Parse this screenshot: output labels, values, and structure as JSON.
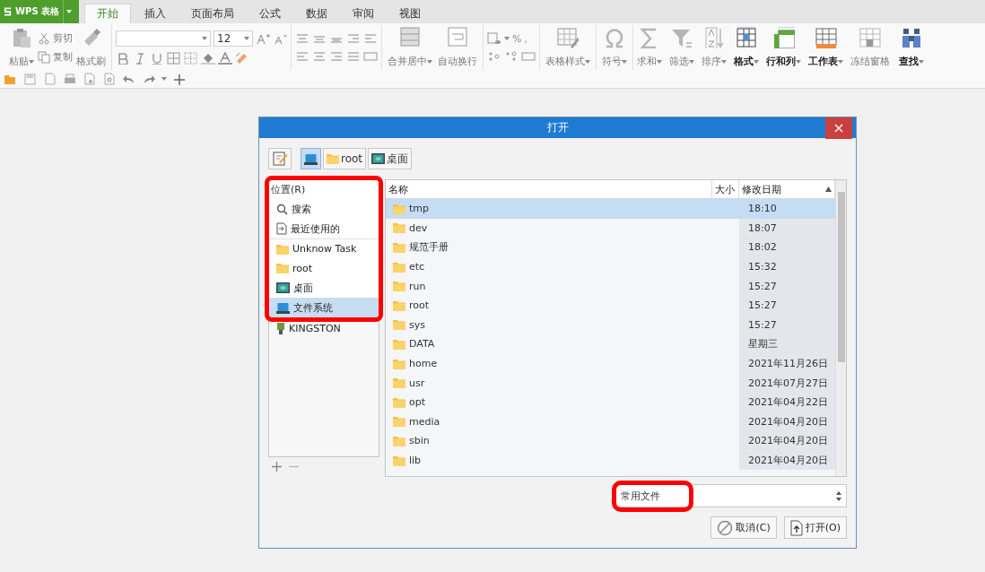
{
  "app_button": {
    "label": "WPS 表格"
  },
  "tabs": [
    {
      "label": "开始",
      "selected": true
    },
    {
      "label": "插入",
      "selected": false
    },
    {
      "label": "页面布局",
      "selected": false
    },
    {
      "label": "公式",
      "selected": false
    },
    {
      "label": "数据",
      "selected": false
    },
    {
      "label": "审阅",
      "selected": false
    },
    {
      "label": "视图",
      "selected": false
    }
  ],
  "ribbon": {
    "clipboard": [
      {
        "kind": "large",
        "label": "粘贴",
        "menu": true,
        "disabled": true
      },
      {
        "kind": "pair",
        "items": [
          {
            "label": "剪切",
            "disabled": true
          },
          {
            "label": "复制",
            "disabled": true
          }
        ]
      },
      {
        "kind": "large",
        "label": "格式刷",
        "menu": false,
        "disabled": true
      }
    ],
    "font_size": "12",
    "merge": [
      {
        "label": "合并居中",
        "menu": true,
        "disabled": true
      },
      {
        "label": "自动换行",
        "menu": false,
        "disabled": true
      }
    ],
    "number_symbols": [
      "%",
      ","
    ],
    "commands": [
      {
        "label": "表格样式",
        "menu": true,
        "disabled": true
      },
      {
        "label": "符号",
        "menu": true,
        "disabled": true
      },
      {
        "label": "求和",
        "menu": true,
        "disabled": true
      },
      {
        "label": "筛选",
        "menu": true,
        "disabled": true
      },
      {
        "label": "排序",
        "menu": true,
        "disabled": true
      },
      {
        "label": "格式",
        "menu": true,
        "disabled": false
      },
      {
        "label": "行和列",
        "menu": true,
        "disabled": false
      },
      {
        "label": "工作表",
        "menu": true,
        "disabled": false
      },
      {
        "label": "冻结窗格",
        "menu": false,
        "disabled": true
      },
      {
        "label": "查找",
        "menu": true,
        "disabled": false
      }
    ]
  },
  "dialog": {
    "title": "打开",
    "path": [
      {
        "kind": "drive",
        "selected": true
      },
      {
        "kind": "folder",
        "label": "root",
        "selected": false
      },
      {
        "kind": "desktop",
        "label": "桌面",
        "selected": false
      }
    ],
    "places": {
      "header": "位置(R)",
      "highlighted": true,
      "items": [
        {
          "kind": "search",
          "label": "搜索",
          "selected": false
        },
        {
          "kind": "recent",
          "label": "最近使用的",
          "selected": false
        },
        {
          "kind": "folder",
          "label": "Unknow Task",
          "selected": false
        },
        {
          "kind": "folder",
          "label": "root",
          "selected": false
        },
        {
          "kind": "desktop",
          "label": "桌面",
          "selected": false
        },
        {
          "kind": "drive",
          "label": "文件系统",
          "selected": true
        }
      ],
      "extra": [
        {
          "kind": "usb",
          "label": "KINGSTON",
          "selected": false
        }
      ]
    },
    "columns": [
      {
        "label": "名称",
        "sorted": false
      },
      {
        "label": "大小",
        "sorted": false
      },
      {
        "label": "修改日期",
        "sorted": true
      }
    ],
    "files": [
      {
        "name": "tmp",
        "modified": "18:10",
        "selected": true
      },
      {
        "name": "dev",
        "modified": "18:07",
        "selected": false
      },
      {
        "name": "规范手册",
        "modified": "18:02",
        "selected": false
      },
      {
        "name": "etc",
        "modified": "15:32",
        "selected": false
      },
      {
        "name": "run",
        "modified": "15:27",
        "selected": false
      },
      {
        "name": "root",
        "modified": "15:27",
        "selected": false
      },
      {
        "name": "sys",
        "modified": "15:27",
        "selected": false
      },
      {
        "name": "DATA",
        "modified": "星期三",
        "selected": false
      },
      {
        "name": "home",
        "modified": "2021年11月26日",
        "selected": false
      },
      {
        "name": "usr",
        "modified": "2021年07月27日",
        "selected": false
      },
      {
        "name": "opt",
        "modified": "2021年04月22日",
        "selected": false
      },
      {
        "name": "media",
        "modified": "2021年04月20日",
        "selected": false
      },
      {
        "name": "sbin",
        "modified": "2021年04月20日",
        "selected": false
      },
      {
        "name": "lib",
        "modified": "2021年04月20日",
        "selected": false
      }
    ],
    "filter": {
      "value": "常用文件",
      "highlighted": true
    },
    "buttons": [
      {
        "kind": "cancel",
        "label": "取消(C)"
      },
      {
        "kind": "open",
        "label": "打开(O)"
      }
    ]
  }
}
